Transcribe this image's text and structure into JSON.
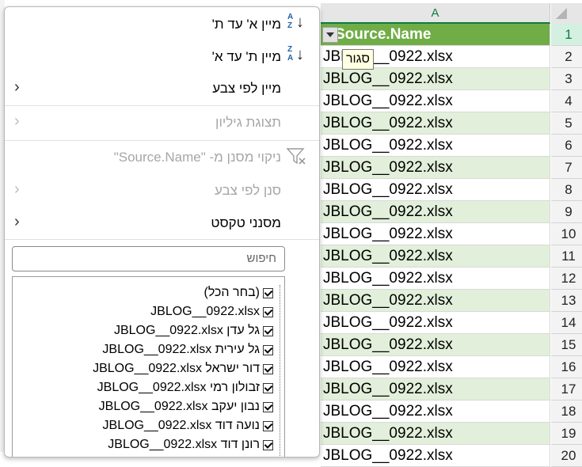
{
  "sheet": {
    "column_header": "A",
    "rows": [
      {
        "num": "1",
        "value": "Source.Name",
        "header": true
      },
      {
        "num": "2",
        "value": "JBLOG__0922.xlsx"
      },
      {
        "num": "3",
        "value": "JBLOG__0922.xlsx"
      },
      {
        "num": "4",
        "value": "JBLOG__0922.xlsx"
      },
      {
        "num": "5",
        "value": "JBLOG__0922.xlsx"
      },
      {
        "num": "6",
        "value": "JBLOG__0922.xlsx"
      },
      {
        "num": "7",
        "value": "JBLOG__0922.xlsx"
      },
      {
        "num": "8",
        "value": "JBLOG__0922.xlsx"
      },
      {
        "num": "9",
        "value": "JBLOG__0922.xlsx"
      },
      {
        "num": "10",
        "value": "JBLOG__0922.xlsx"
      },
      {
        "num": "11",
        "value": "JBLOG__0922.xlsx"
      },
      {
        "num": "12",
        "value": "JBLOG__0922.xlsx"
      },
      {
        "num": "13",
        "value": "JBLOG__0922.xlsx"
      },
      {
        "num": "14",
        "value": "JBLOG__0922.xlsx"
      },
      {
        "num": "15",
        "value": "JBLOG__0922.xlsx"
      },
      {
        "num": "16",
        "value": "JBLOG__0922.xlsx"
      },
      {
        "num": "17",
        "value": "JBLOG__0922.xlsx"
      },
      {
        "num": "18",
        "value": "JBLOG__0922.xlsx"
      },
      {
        "num": "19",
        "value": "JBLOG__0922.xlsx"
      },
      {
        "num": "20",
        "value": "JBLOG__0922.xlsx"
      }
    ],
    "tooltip": "סגור",
    "colors": {
      "header_fill": "#70ad47",
      "band_fill": "#e2efda",
      "accent": "#107c41"
    }
  },
  "menu": {
    "sort_asc": {
      "label": "מיין א' עד ת'",
      "icon": "sort-a-to-z-icon",
      "icon_top": "A",
      "icon_bottom": "Z"
    },
    "sort_desc": {
      "label": "מיין ת' עד א'",
      "icon": "sort-z-to-a-icon",
      "icon_top": "Z",
      "icon_bottom": "A"
    },
    "sort_by_color": {
      "label": "מיין לפי צבע"
    },
    "sheet_view": {
      "label": "תצוגת גיליון",
      "enabled": false
    },
    "clear_filter": {
      "label": "ניקוי מסנן מ- \"Source.Name\"",
      "enabled": false,
      "icon": "clear-filter-icon"
    },
    "filter_by_color": {
      "label": "סנן לפי צבע",
      "enabled": false
    },
    "text_filters": {
      "label": "מסנני טקסט"
    },
    "search": {
      "placeholder": "חיפוש",
      "icon": "search-icon"
    },
    "list": [
      {
        "label": "(בחר הכל)",
        "checked": true
      },
      {
        "label": "JBLOG__0922.xlsx",
        "checked": true
      },
      {
        "label": "גל עדן JBLOG__0922.xlsx",
        "checked": true
      },
      {
        "label": "גל עירית JBLOG__0922.xlsx",
        "checked": true
      },
      {
        "label": "דור ישראל JBLOG__0922.xlsx",
        "checked": true
      },
      {
        "label": "זבולון רמי JBLOG__0922.xlsx",
        "checked": true
      },
      {
        "label": "נבון יעקב JBLOG__0922.xlsx",
        "checked": true
      },
      {
        "label": "נועה דוד JBLOG__0922.xlsx",
        "checked": true
      },
      {
        "label": "רונן דוד JBLOG__0922.xlsx",
        "checked": true
      }
    ]
  }
}
